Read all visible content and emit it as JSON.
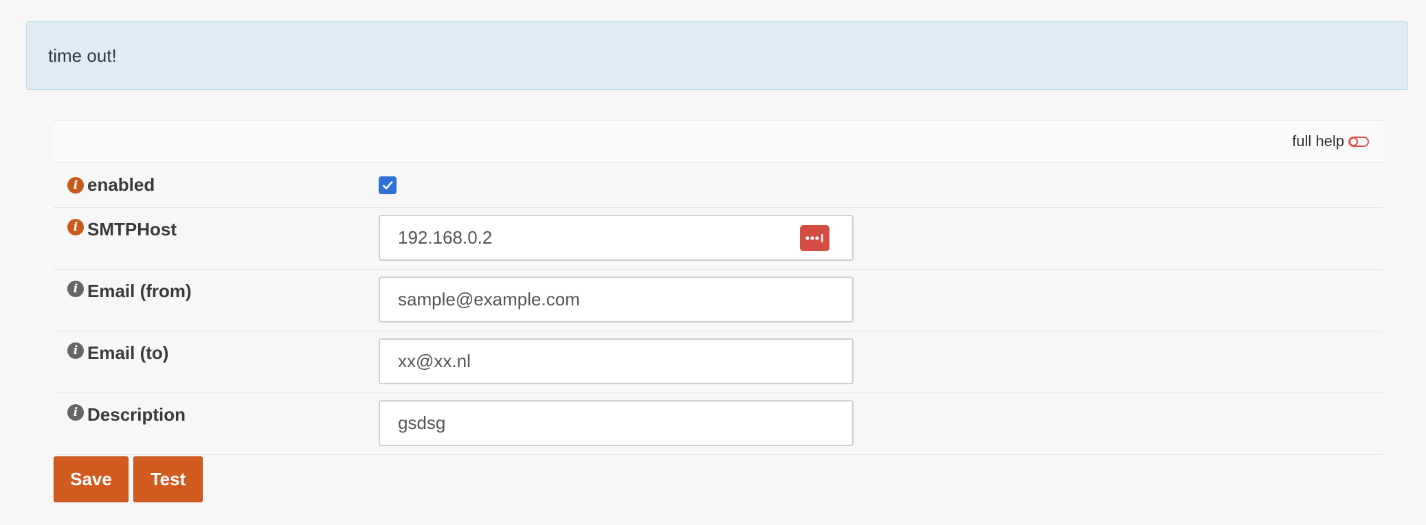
{
  "alert": {
    "message": "time out!"
  },
  "help": {
    "label": "full help"
  },
  "fields": {
    "enabled": {
      "label": "enabled",
      "checked": true
    },
    "smtp_host": {
      "label": "SMTPHost",
      "value": "192.168.0.2"
    },
    "email_from": {
      "label": "Email (from)",
      "value": "sample@example.com"
    },
    "email_to": {
      "label": "Email (to)",
      "value": "xx@xx.nl"
    },
    "description": {
      "label": "Description",
      "value": "gsdsg"
    }
  },
  "buttons": {
    "save": "Save",
    "test": "Test"
  },
  "icons": {
    "info_required": "info-icon",
    "info_optional": "info-icon",
    "toggle": "toggle-icon",
    "password_manager": "password-manager-icon",
    "check": "checkmark-icon"
  },
  "colors": {
    "accent": "#d15a1f",
    "alert_bg": "#dfecf6",
    "checkbox": "#2f6fd8",
    "toggle": "#d9534f"
  }
}
